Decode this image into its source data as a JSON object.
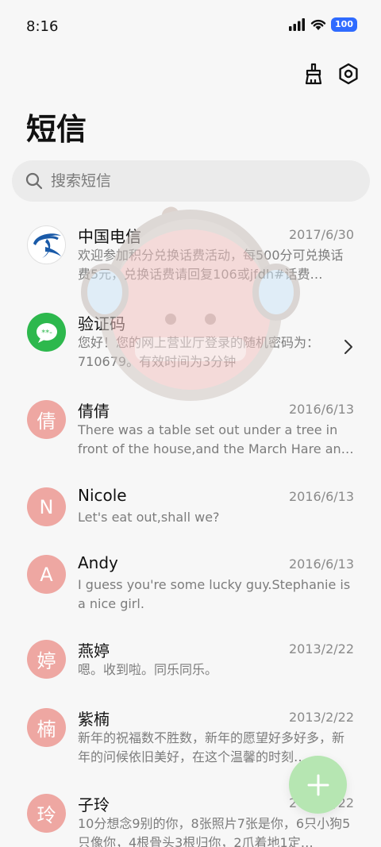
{
  "status_bar": {
    "time": "8:16",
    "battery": "100"
  },
  "header": {
    "title": "短信"
  },
  "toolbar": {
    "clean_icon": "brush-icon",
    "settings_icon": "settings-icon"
  },
  "search": {
    "placeholder": "搜索短信"
  },
  "conversations": [
    {
      "name": "中国电信",
      "date": "2017/6/30",
      "preview": "欢迎参加积分兑换话费活动，每500分可兑换话费5元，兑换话费请回复106或jfdh#话费…",
      "avatar_type": "telecom-logo"
    },
    {
      "name": "验证码",
      "date": "",
      "preview": "您好！您的网上营业厅登录的随机密码为：710679。有效时间为3分钟",
      "avatar_type": "message-bubble-icon"
    },
    {
      "name": "倩倩",
      "date": "2016/6/13",
      "preview": "There was a table set out under a tree in front of the house,and the March Hare an…",
      "avatar_letter": "倩"
    },
    {
      "name": "Nicole",
      "date": "2016/6/13",
      "preview": "Let's eat out,shall we?",
      "avatar_letter": "N"
    },
    {
      "name": "Andy",
      "date": "2016/6/13",
      "preview": "I guess you're some lucky guy.Stephanie is a nice girl.",
      "avatar_letter": "A"
    },
    {
      "name": "燕婷",
      "date": "2013/2/22",
      "preview": "嗯。收到啦。同乐同乐。",
      "avatar_letter": "婷"
    },
    {
      "name": "紫楠",
      "date": "2013/2/22",
      "preview": "新年的祝福数不胜数，新年的愿望好多好多，新年的问候依旧美好，在这个温馨的时刻…",
      "avatar_letter": "楠"
    },
    {
      "name": "子玲",
      "date": "2013/2/22",
      "preview": "10分想念9别的你，8张照片7张是你，6只小狗5只像你，4根骨头3根归你，2爪着地1定…",
      "avatar_letter": "玲"
    }
  ],
  "colors": {
    "avatar_pink": "#eea7a2",
    "telecom_blue": "#1a5aa8",
    "bubble_green": "#2db84d",
    "fab_green": "#b6e6b2"
  },
  "fab": {
    "icon": "plus-icon"
  }
}
